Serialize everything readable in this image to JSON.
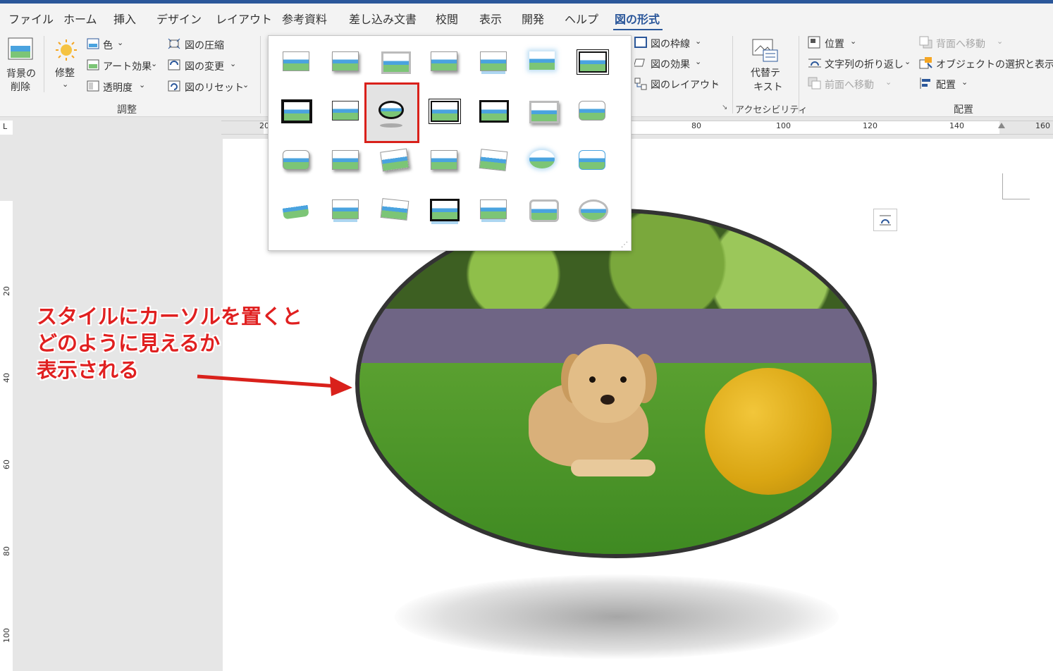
{
  "tabs": [
    "ファイル",
    "ホーム",
    "挿入",
    "デザイン",
    "レイアウト",
    "参考資料",
    "差し込み文書",
    "校閲",
    "表示",
    "開発",
    "ヘルプ",
    "図の形式"
  ],
  "ribbon": {
    "remove_bg": [
      "背景の",
      "削除"
    ],
    "corrections": "修整",
    "color": "色",
    "art_effects": "アート効果",
    "transparency": "透明度",
    "compress": "図の圧縮",
    "change": "図の変更",
    "reset": "図のリセット",
    "adjust_group": "調整",
    "border": "図の枠線",
    "effects": "図の効果",
    "layout": "図のレイアウト",
    "alt_text": [
      "代替テ",
      "キスト"
    ],
    "accessibility_group": "アクセシビリティ",
    "position": "位置",
    "wrap_text": "文字列の折り返し",
    "bring_forward": "前面へ移動",
    "send_backward": "背面へ移動",
    "selection_pane": "オブジェクトの選択と表示",
    "align": "配置",
    "arrange_group": "配置"
  },
  "ruler": {
    "h_left": "20",
    "h": [
      "80",
      "100",
      "120",
      "140",
      "160"
    ],
    "v": [
      "20",
      "40",
      "60",
      "80",
      "100"
    ]
  },
  "annotation": {
    "lines": [
      "スタイルにカーソルを置くと",
      "どのように見えるか",
      "表示される"
    ],
    "color": "#e02020"
  },
  "colors": {
    "accent": "#2b579a",
    "highlight": "#d9211b"
  },
  "gallery": {
    "selected_index": 9,
    "selected_style": "oval black frame with shadow"
  }
}
